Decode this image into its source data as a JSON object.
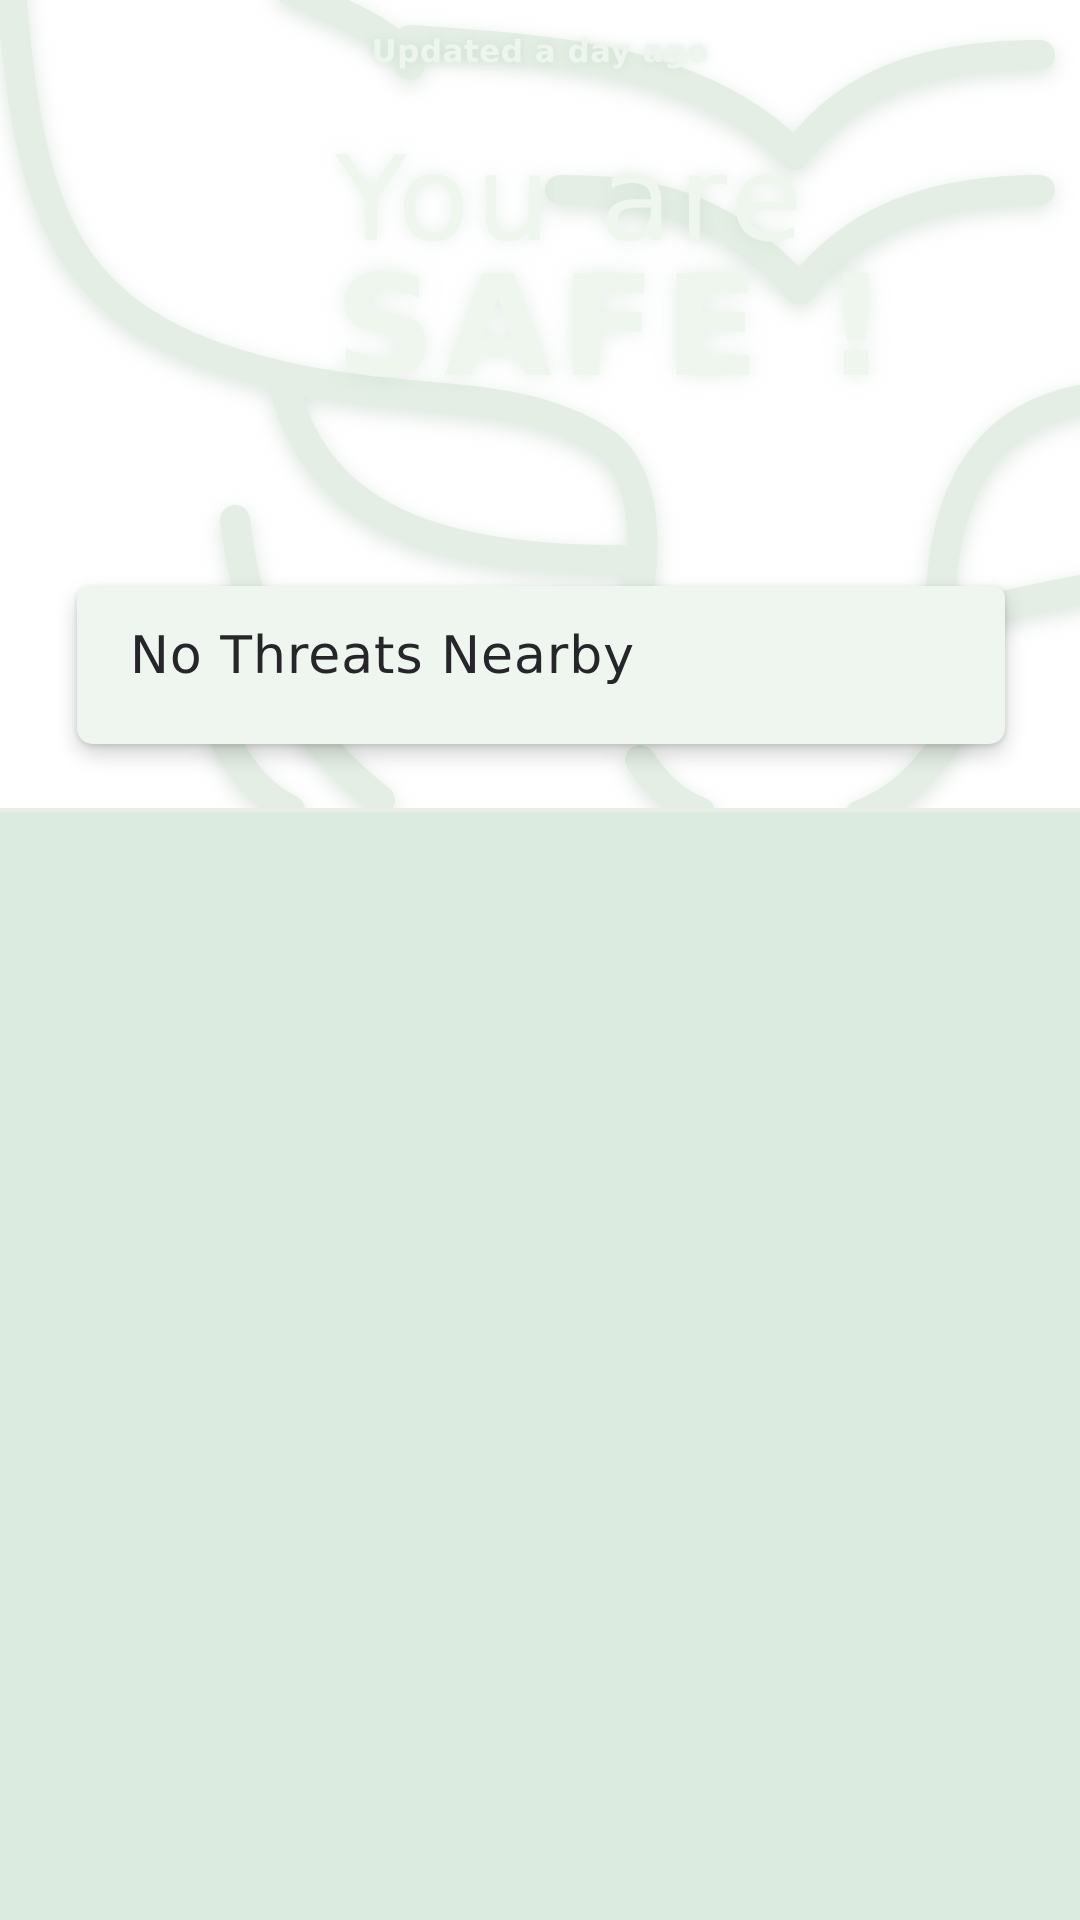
{
  "header": {
    "updated_text": "Updated a day ago"
  },
  "hero": {
    "line1": "You are",
    "line2": "SAFE !"
  },
  "status": {
    "label": "No Threats Nearby"
  },
  "colors": {
    "hero_background": "#ffffff",
    "hero_text": "#eef6ee",
    "leaf_outline": "#e4eee4",
    "card_background": "#eff6ef",
    "card_text": "#26262a",
    "lower_panel": "#dcebdf"
  },
  "icons": {
    "background": "leaf-background-icon",
    "bird": "bird-icon"
  }
}
